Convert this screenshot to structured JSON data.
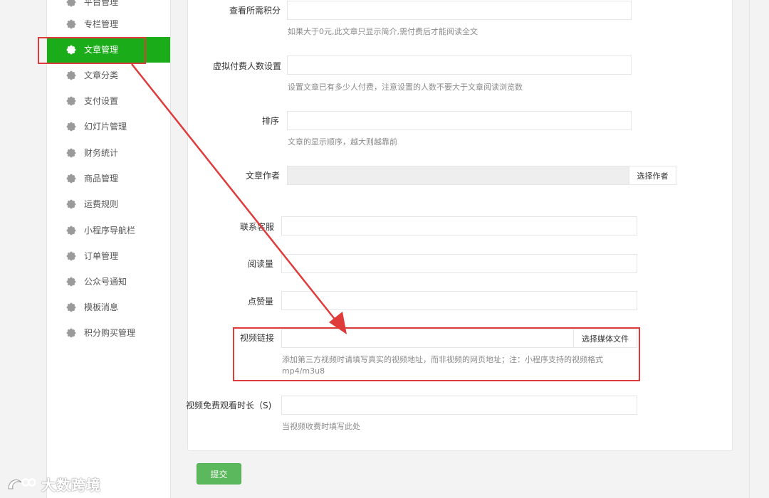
{
  "sidebar": {
    "items": [
      {
        "label": "平台管理"
      },
      {
        "label": "专栏管理"
      },
      {
        "label": "文章管理"
      },
      {
        "label": "文章分类"
      },
      {
        "label": "支付设置"
      },
      {
        "label": "幻灯片管理"
      },
      {
        "label": "财务统计"
      },
      {
        "label": "商品管理"
      },
      {
        "label": "运费规则"
      },
      {
        "label": "小程序导航栏"
      },
      {
        "label": "订单管理"
      },
      {
        "label": "公众号通知"
      },
      {
        "label": "模板消息"
      },
      {
        "label": "积分购买管理"
      }
    ],
    "active_index": 2
  },
  "form": {
    "points": {
      "label": "查看所需积分",
      "value": "",
      "help": "如果大于0元,此文章只显示简介,需付费后才能阅读全文"
    },
    "virtual_payers": {
      "label": "虚拟付费人数设置",
      "value": "",
      "help": "设置文章已有多少人付费，注意设置的人数不要大于文章阅读浏览数"
    },
    "sort": {
      "label": "排序",
      "value": "",
      "help": "文章的显示顺序，越大则越靠前"
    },
    "author": {
      "label": "文章作者",
      "value": "",
      "button": "选择作者"
    },
    "contact": {
      "label": "联系客服",
      "value": ""
    },
    "reads": {
      "label": "阅读量",
      "value": ""
    },
    "likes": {
      "label": "点赞量",
      "value": ""
    },
    "video_link": {
      "label": "视频链接",
      "value": "",
      "button": "选择媒体文件",
      "help_line1": "添加第三方视频时请填写真实的视频地址，而非视频的网页地址；注：小程序支持的视频格式",
      "help_line2": "mp4/m3u8"
    },
    "free_duration": {
      "label": "视频免费观看时长（S)",
      "value": "",
      "help": "当视频收费时填写此处"
    },
    "submit_label": "提交"
  },
  "watermark": {
    "text": "大数跨境"
  },
  "colors": {
    "active_green": "#1aad19",
    "submit_green": "#5cb85c",
    "annotation_red": "#e03b3b"
  }
}
